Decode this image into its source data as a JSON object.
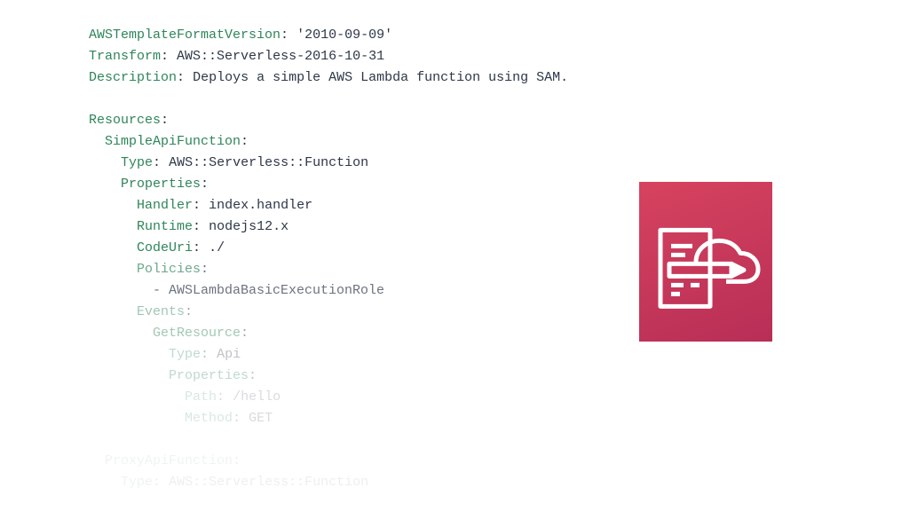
{
  "code": {
    "l1k": "AWSTemplateFormatVersion",
    "l1v": "'2010-09-09'",
    "l2k": "Transform",
    "l2v": "AWS::Serverless-2016-10-31",
    "l3k": "Description",
    "l3v": "Deploys a simple AWS Lambda function using SAM.",
    "l5k": "Resources",
    "l6k": "SimpleApiFunction",
    "l7k": "Type",
    "l7v": "AWS::Serverless::Function",
    "l8k": "Properties",
    "l9k": "Handler",
    "l9v": "index.handler",
    "l10k": "Runtime",
    "l10v": "nodejs12.x",
    "l11k": "CodeUri",
    "l11v": "./",
    "l12k": "Policies",
    "l13v": "- AWSLambdaBasicExecutionRole",
    "l14k": "Events",
    "l15k": "GetResource",
    "l16k": "Type",
    "l16v": "Api",
    "l17k": "Properties",
    "l18k": "Path",
    "l18v": "/hello",
    "l19k": "Method",
    "l19v": "GET",
    "l21k": "ProxyApiFunction",
    "l22k": "Type",
    "l22v": "AWS::Serverless::Function"
  },
  "icon_name": "cloudformation-template-icon"
}
